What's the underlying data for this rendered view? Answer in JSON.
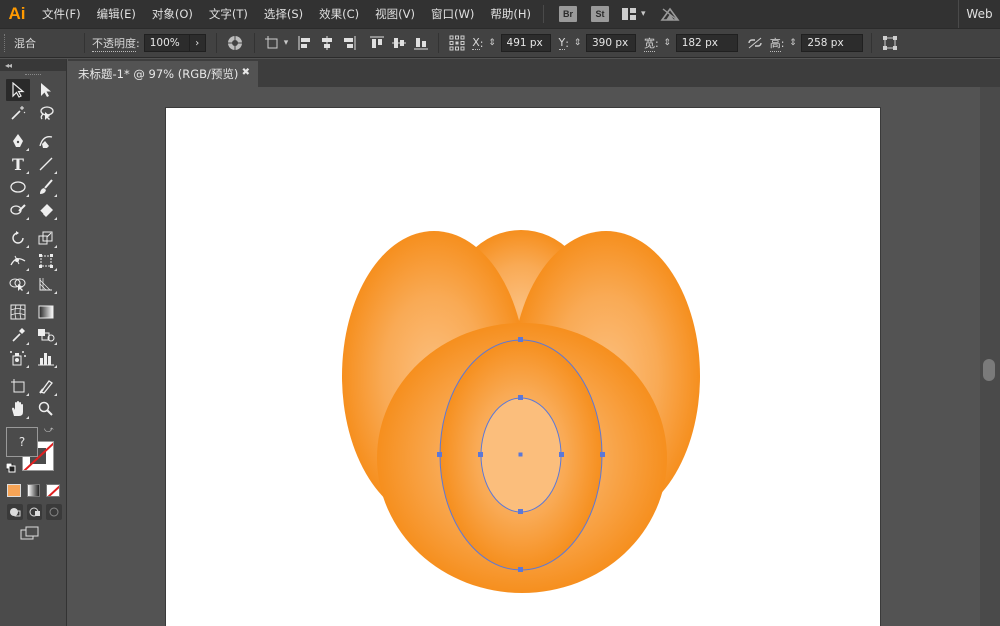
{
  "app": {
    "logo": "Ai",
    "menus": [
      "文件(F)",
      "编辑(E)",
      "对象(O)",
      "文字(T)",
      "选择(S)",
      "效果(C)",
      "视图(V)",
      "窗口(W)",
      "帮助(H)"
    ],
    "bridge_label": "Br",
    "stock_label": "St",
    "workspace_label": "Web"
  },
  "control_bar": {
    "blend_label": "混合",
    "opacity_label": "不透明度",
    "opacity_value": "100%",
    "x_label": "X",
    "x_value": "491 px",
    "y_label": "Y",
    "y_value": "390 px",
    "width_label": "宽",
    "width_value": "182 px",
    "height_label": "高",
    "height_value": "258 px"
  },
  "document": {
    "tab_title": "未标题-1* @ 97% (RGB/预览)"
  },
  "toolbar": {
    "fill_placeholder": "?",
    "collapse_glyph": "◂◂"
  },
  "colors": {
    "accent": "#ff9a00",
    "petal_edge": "#f79321",
    "petal_center": "#fbbf7e",
    "selection": "#5b78d8"
  }
}
